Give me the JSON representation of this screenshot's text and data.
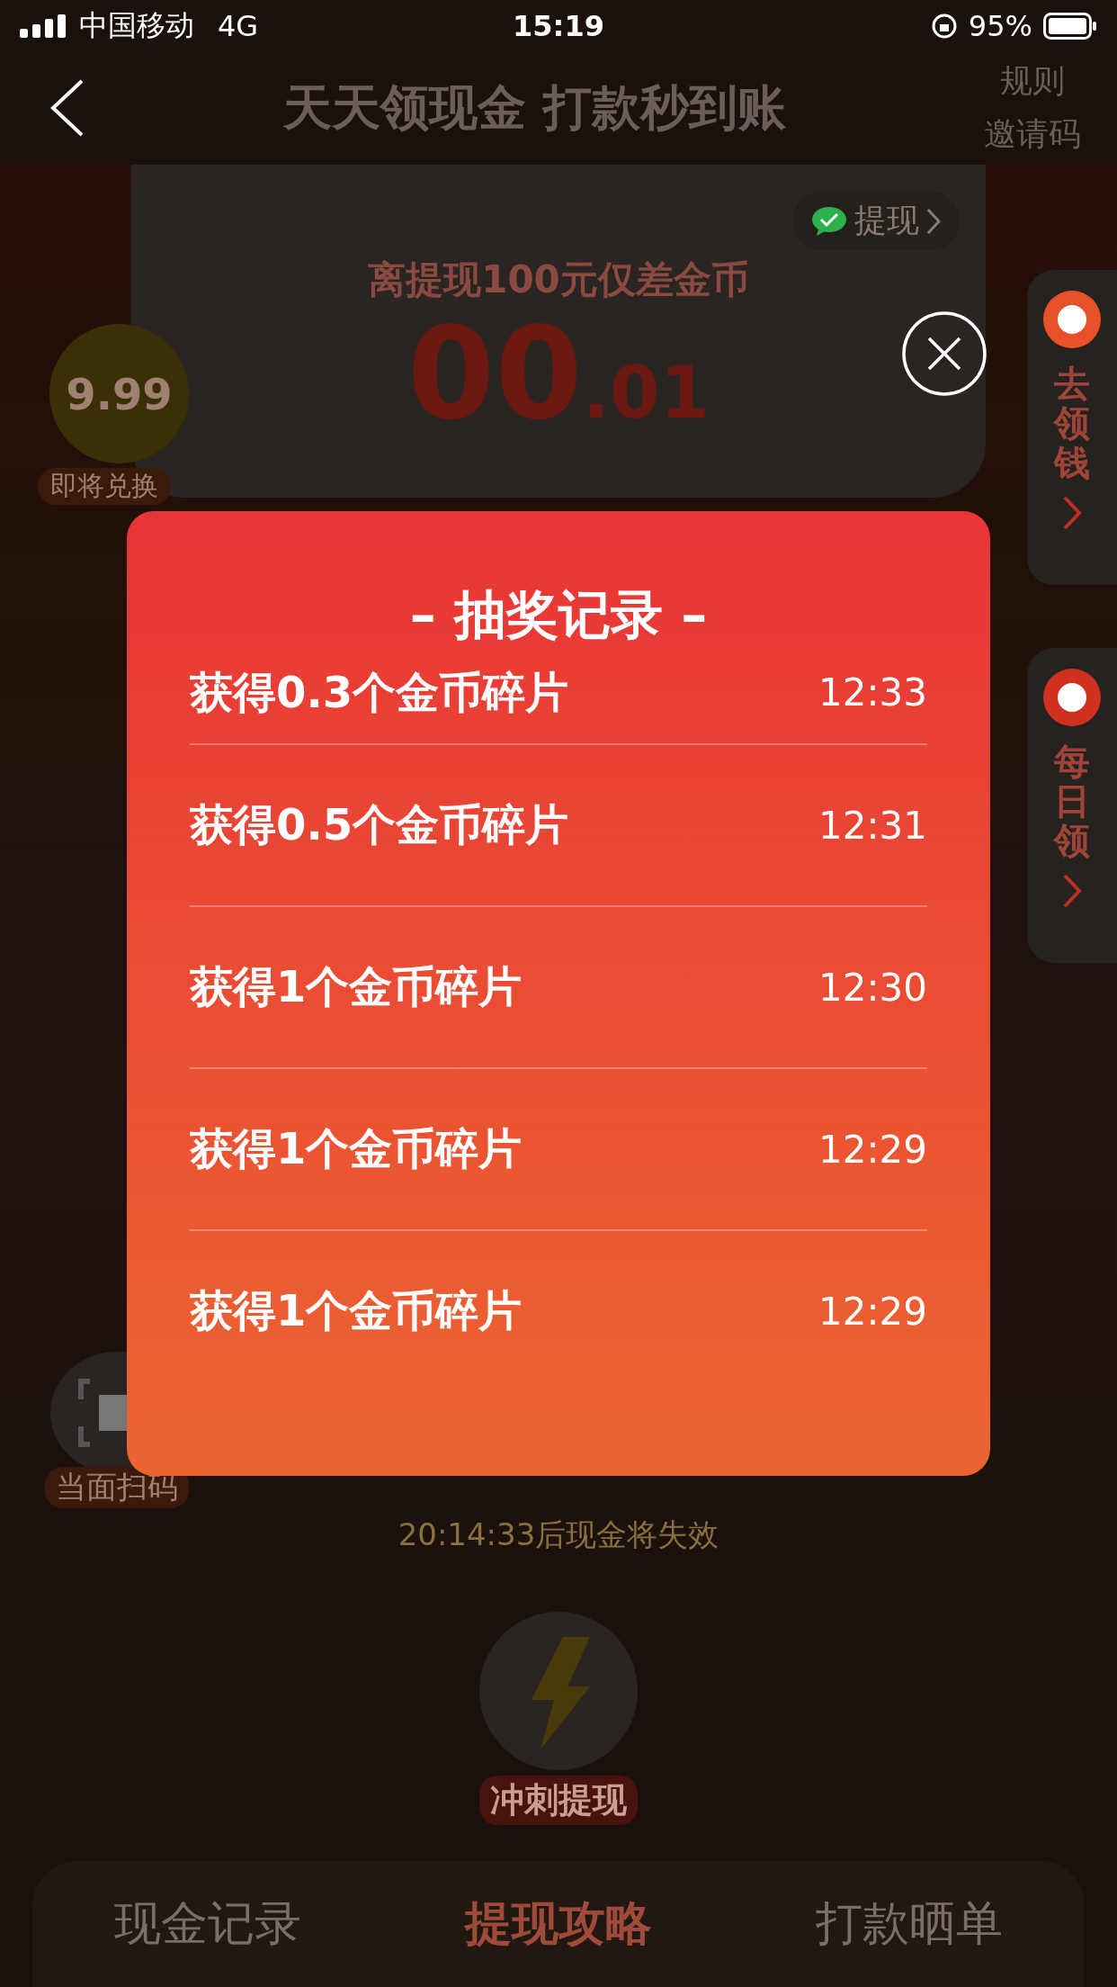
{
  "status_bar": {
    "carrier": "中国移动",
    "network": "4G",
    "time": "15:19",
    "battery": "95%"
  },
  "nav": {
    "title": "天天领现金 打款秒到账",
    "links": [
      "规则",
      "邀请码"
    ]
  },
  "withdraw_card": {
    "withdraw_button": "提现",
    "caption": "离提现100元仅差金币",
    "amount_int": "00",
    "amount_dec": ".01"
  },
  "coin_badge": {
    "value": "9.99",
    "label": "即将兑换"
  },
  "side_tabs": [
    {
      "label": "去领钱"
    },
    {
      "label": "每日领"
    }
  ],
  "scan": {
    "label": "当面扫码"
  },
  "countdown": "20:14:33后现金将失效",
  "sprint": {
    "label": "冲刺提现"
  },
  "bottom_tabs": [
    {
      "label": "现金记录",
      "selected": false
    },
    {
      "label": "提现攻略",
      "selected": true
    },
    {
      "label": "打款晒单",
      "selected": false
    }
  ],
  "dialog": {
    "title": "– 抽奖记录 –",
    "records": [
      {
        "text": "获得0.3个金币碎片",
        "time": "12:33"
      },
      {
        "text": "获得0.5个金币碎片",
        "time": "12:31"
      },
      {
        "text": "获得1个金币碎片",
        "time": "12:30"
      },
      {
        "text": "获得1个金币碎片",
        "time": "12:29"
      },
      {
        "text": "获得1个金币碎片",
        "time": "12:29"
      }
    ]
  }
}
